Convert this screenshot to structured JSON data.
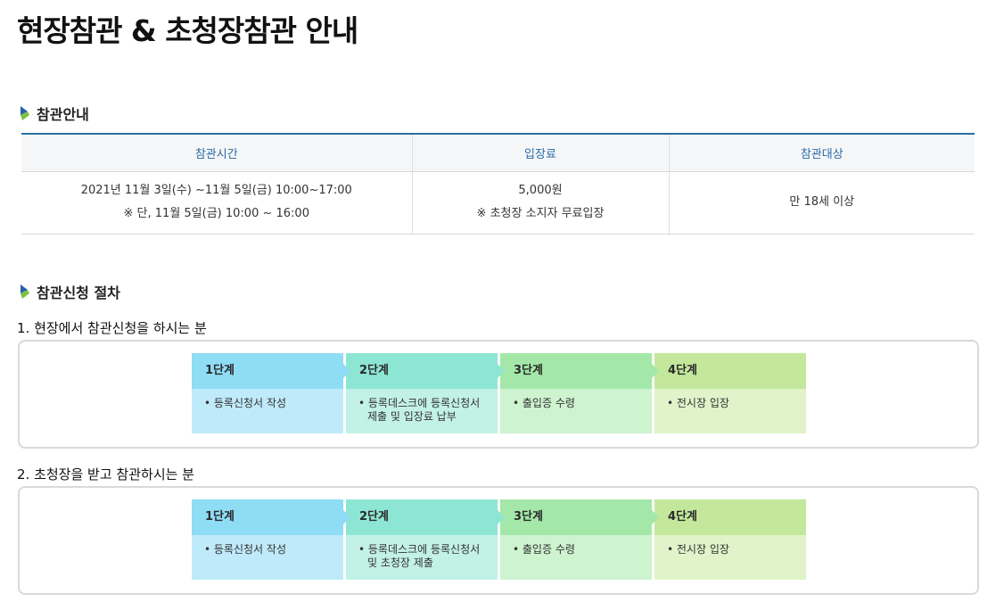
{
  "page": {
    "title": "현장참관 & 초청장참관 안내"
  },
  "visit_info": {
    "heading": "참관안내",
    "columns": [
      "참관시간",
      "입장료",
      "참관대상"
    ],
    "time_line1": "2021년 11월 3일(수) ~11월 5일(금) 10:00~17:00",
    "time_line2": "※ 단, 11월 5일(금) 10:00 ~ 16:00",
    "fee_line1": "5,000원",
    "fee_line2": "※ 초청장 소지자 무료입장",
    "target": "만 18세 이상"
  },
  "procedure": {
    "heading": "참관신청 절차",
    "onsite": {
      "title": "1. 현장에서 참관신청을 하시는 분",
      "steps": [
        {
          "label": "1단계",
          "desc1": "• 등록신청서 작성",
          "desc2": ""
        },
        {
          "label": "2단계",
          "desc1": "• 등록데스크에 등록신청서",
          "desc2": "제출 및 입장료 납부"
        },
        {
          "label": "3단계",
          "desc1": "• 출입증 수령",
          "desc2": ""
        },
        {
          "label": "4단계",
          "desc1": "• 전시장 입장",
          "desc2": ""
        }
      ]
    },
    "invited": {
      "title": "2. 초청장을 받고 참관하시는 분",
      "steps": [
        {
          "label": "1단계",
          "desc1": "• 등록신청서 작성",
          "desc2": ""
        },
        {
          "label": "2단계",
          "desc1": "• 등록데스크에 등록신청서",
          "desc2": "및 초청장 제출"
        },
        {
          "label": "3단계",
          "desc1": "• 출입증 수령",
          "desc2": ""
        },
        {
          "label": "4단계",
          "desc1": "• 전시장 입장",
          "desc2": ""
        }
      ]
    }
  },
  "colors": {
    "table_top_border": "#2c6ea0",
    "table_header_text": "#2a6aa6",
    "step1": "#8fdcf5",
    "step2": "#8de6d4",
    "step3": "#a3e8a8",
    "step4": "#c3e89b"
  },
  "icons": {
    "section_bullet": "bullet-icon"
  }
}
